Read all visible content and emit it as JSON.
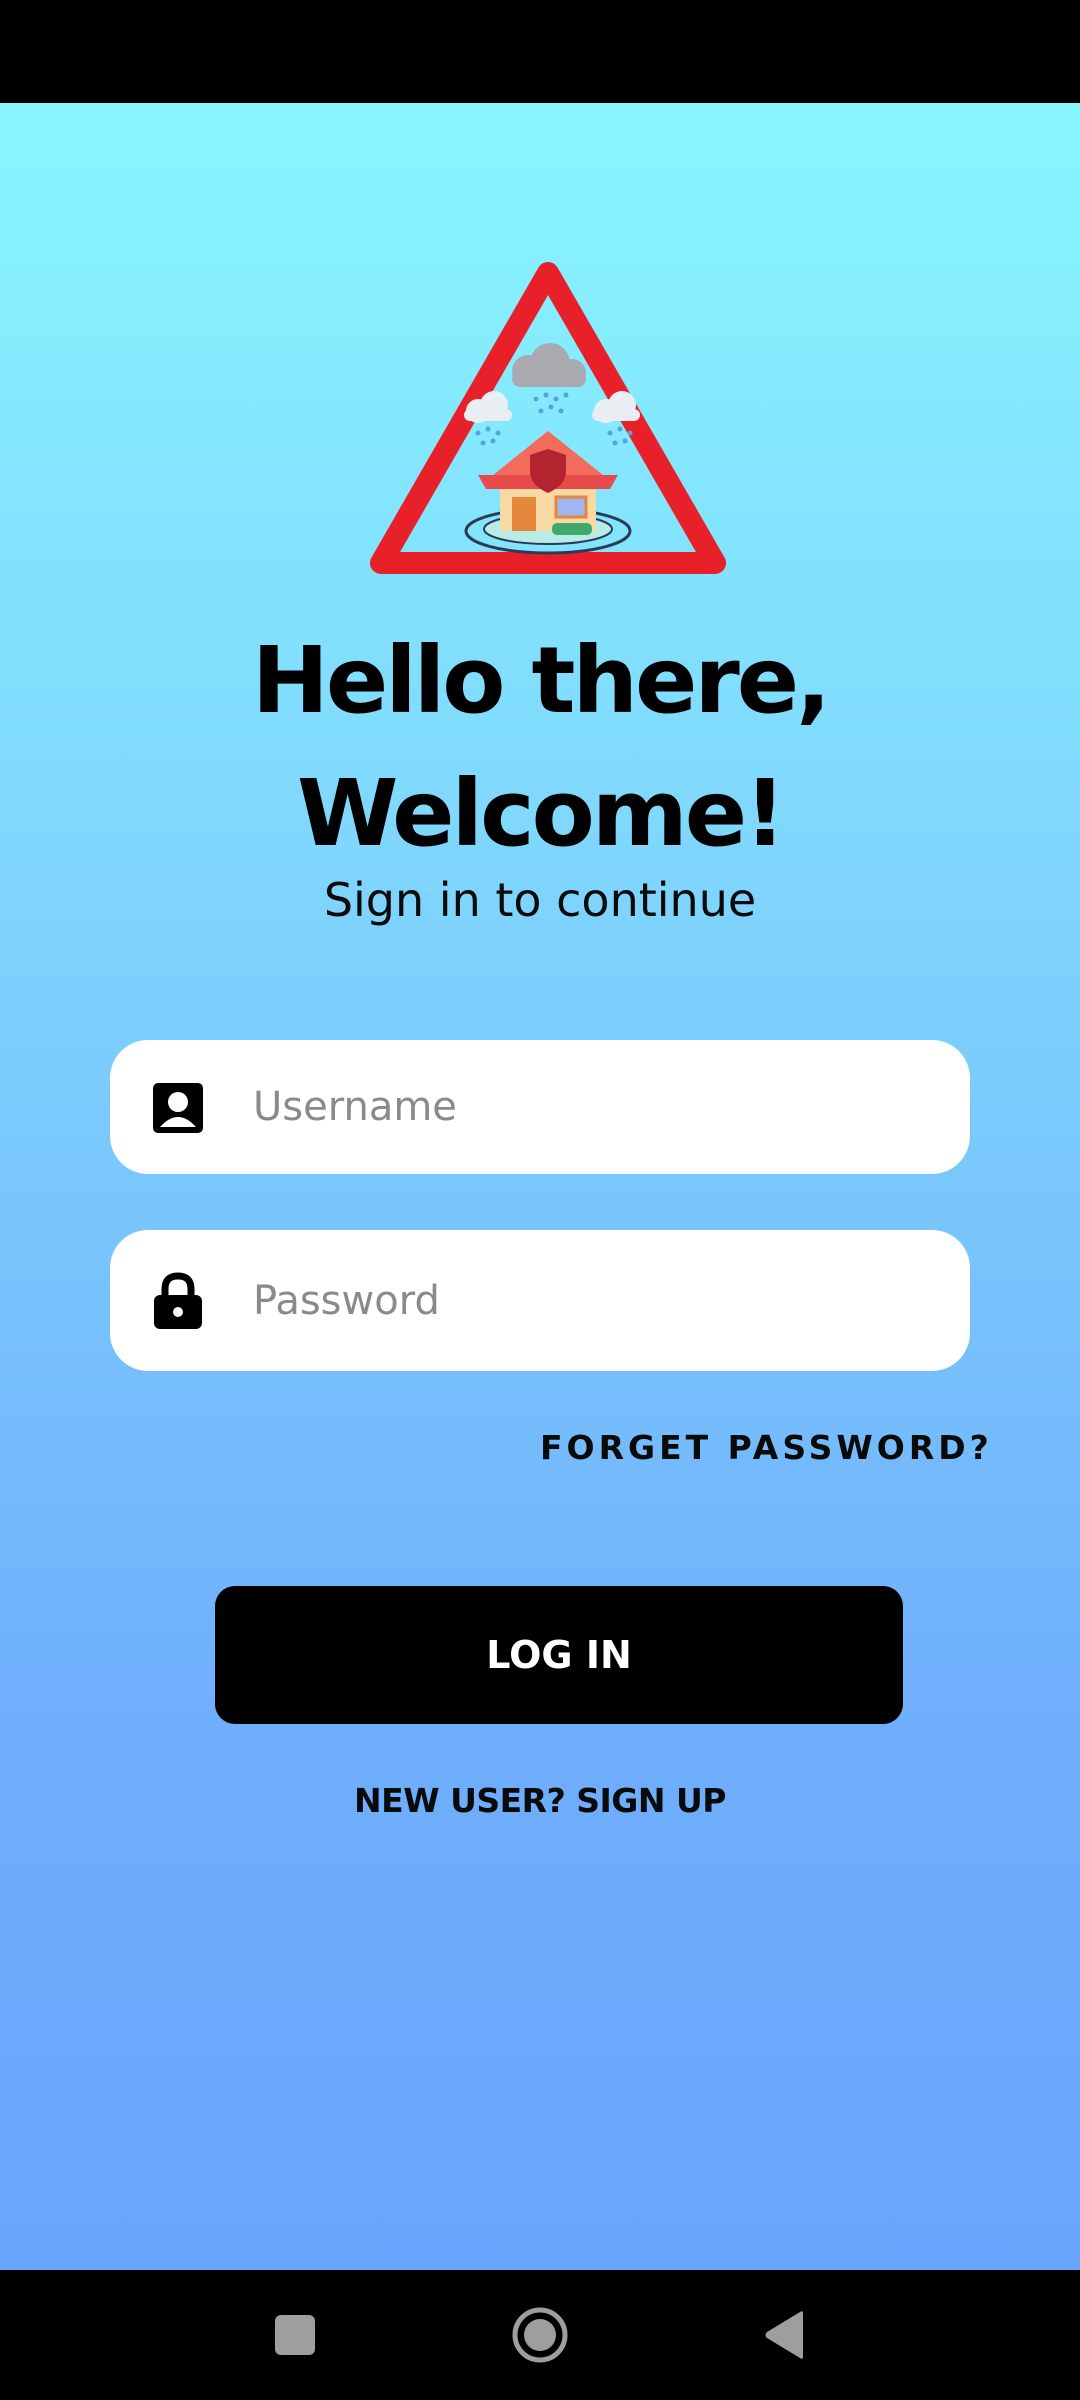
{
  "header": {
    "greeting": "Hello there,",
    "welcome": "Welcome!",
    "subtitle": "Sign in to continue"
  },
  "form": {
    "username": {
      "placeholder": "Username",
      "value": "",
      "icon": "user-badge-icon"
    },
    "password": {
      "placeholder": "Password",
      "value": "",
      "icon": "lock-icon"
    },
    "forgot_label": "FORGET PASSWORD?",
    "login_label": "LOG IN",
    "signup_label": "NEW USER? SIGN UP"
  },
  "logo": {
    "icon": "flood-warning-logo"
  },
  "nav": {
    "recents_icon": "square-recents-icon",
    "home_icon": "circle-home-icon",
    "back_icon": "triangle-back-icon"
  },
  "colors": {
    "gradient_top": "#88f6fe",
    "gradient_bottom": "#68a5fc",
    "button": "#000000",
    "logo_red": "#e8202a"
  }
}
